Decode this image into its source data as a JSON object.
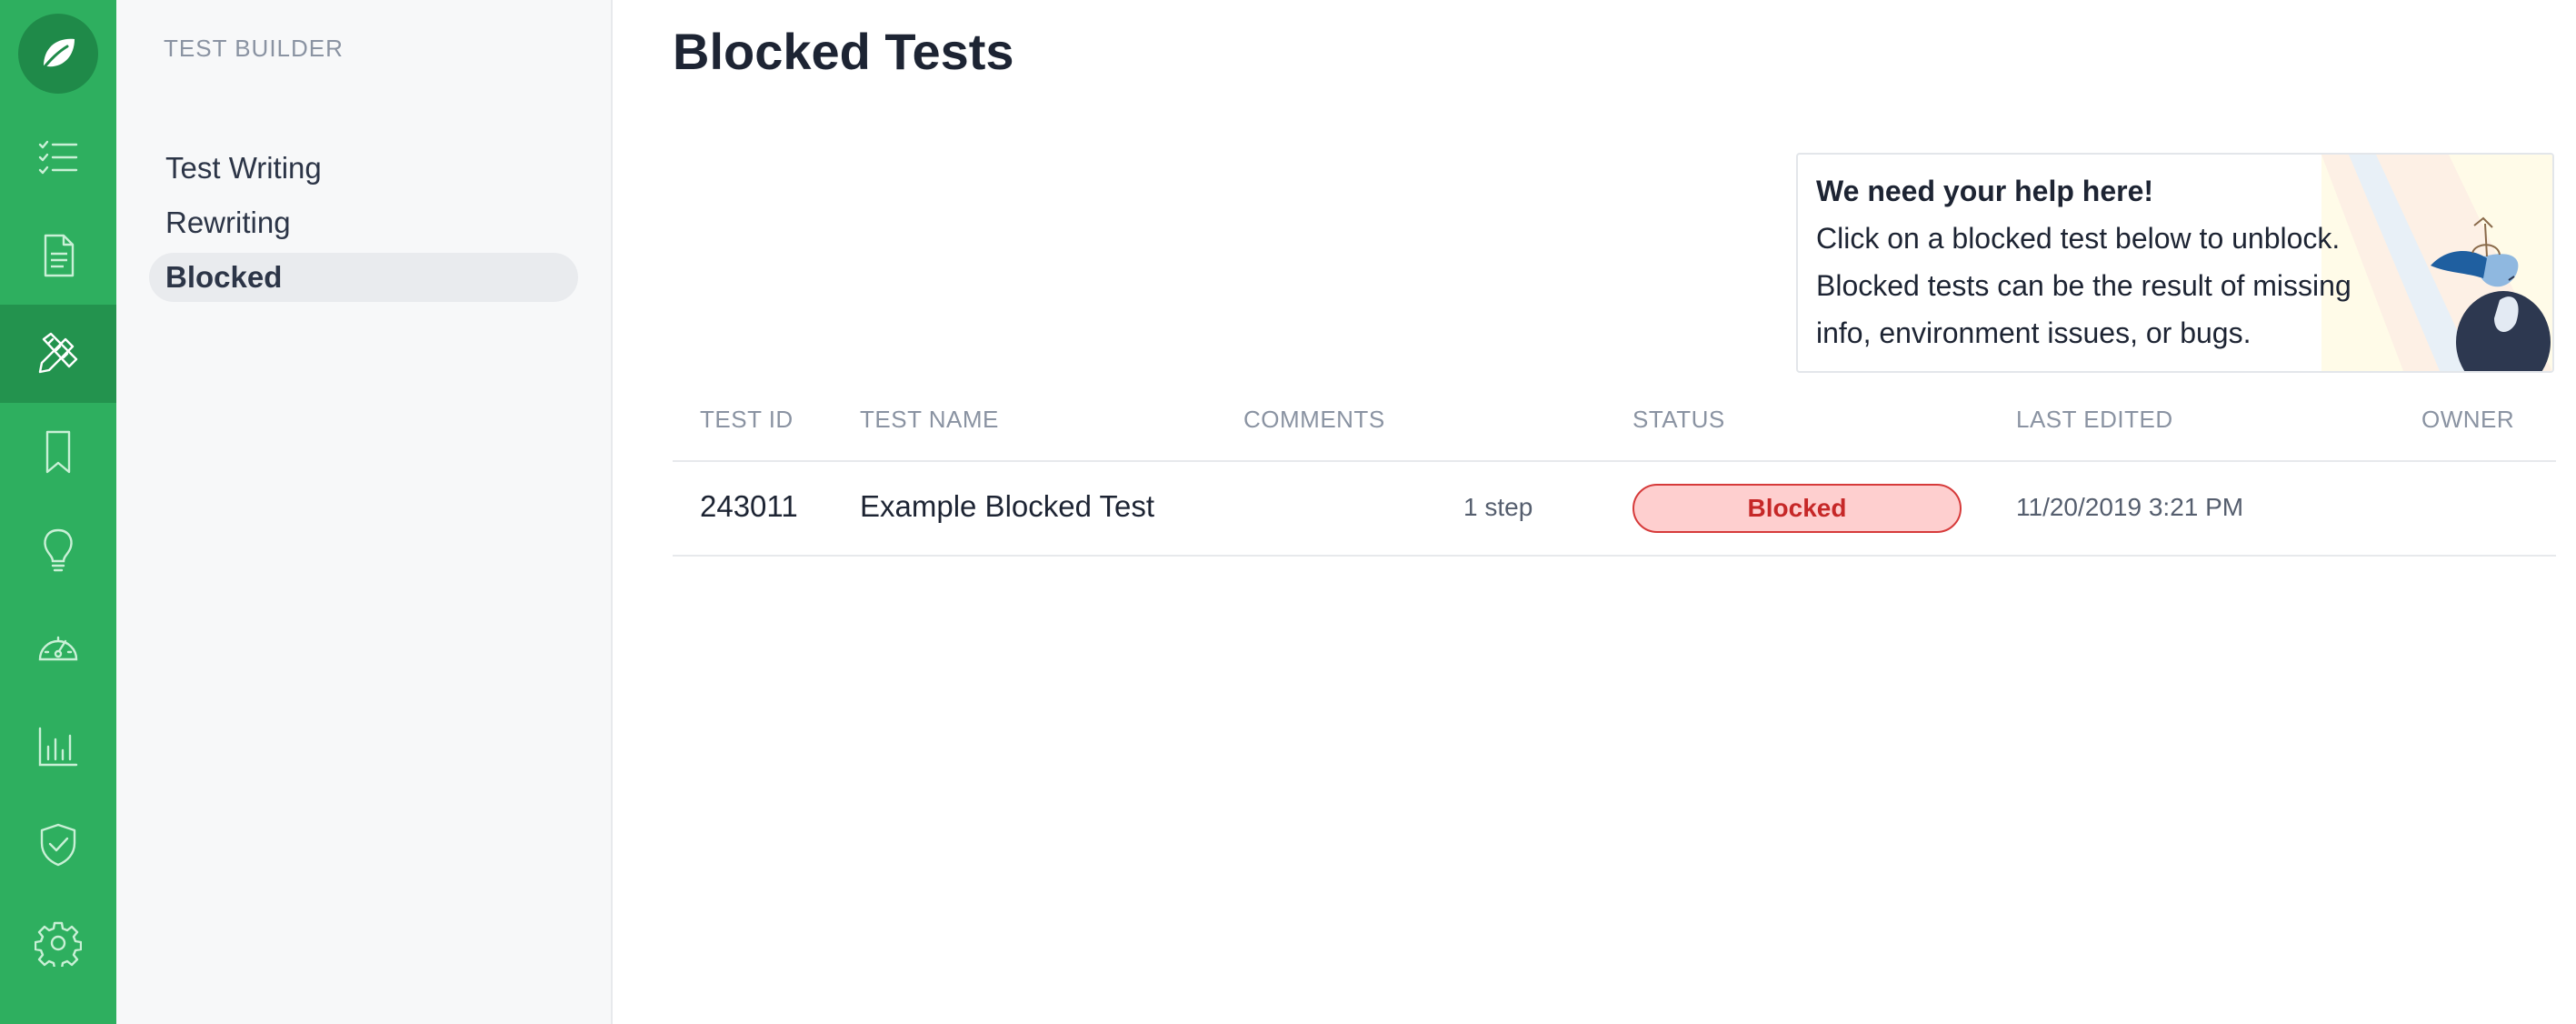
{
  "app": {
    "accent": "#2eaf5f",
    "rail_icons": [
      "leaf-logo-icon",
      "checklist-icon",
      "document-icon",
      "pencil-ruler-icon",
      "bookmark-icon",
      "lightbulb-icon",
      "speedometer-icon",
      "bar-chart-icon",
      "shield-check-icon",
      "gear-icon"
    ],
    "active_rail_icon": "pencil-ruler-icon"
  },
  "sidebar": {
    "title": "TEST BUILDER",
    "items": [
      {
        "label": "Test Writing"
      },
      {
        "label": "Rewriting"
      },
      {
        "label": "Blocked"
      }
    ],
    "active_item": "Blocked"
  },
  "main": {
    "title": "Blocked Tests",
    "help": {
      "heading": "We need your help here!",
      "lines": [
        "Click on a blocked test below to unblock.",
        "Blocked tests can be the result of missing",
        "info, environment issues, or bugs."
      ]
    },
    "table": {
      "headers": {
        "test_id": "TEST ID",
        "test_name": "TEST NAME",
        "comments": "COMMENTS",
        "status": "STATUS",
        "last_edited": "LAST EDITED",
        "owner": "OWNER"
      },
      "rows": [
        {
          "test_id": "243011",
          "test_name": "Example Blocked Test",
          "steps": "1 step",
          "status": "Blocked",
          "last_edited": "11/20/2019 3:21 PM"
        }
      ]
    }
  }
}
